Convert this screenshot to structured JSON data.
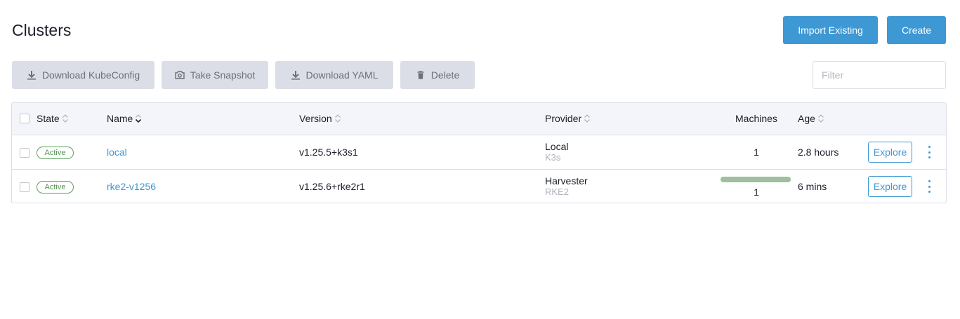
{
  "page": {
    "title": "Clusters"
  },
  "actions": {
    "import_label": "Import Existing",
    "create_label": "Create"
  },
  "bulk": {
    "download_kubeconfig": "Download KubeConfig",
    "take_snapshot": "Take Snapshot",
    "download_yaml": "Download YAML",
    "delete": "Delete"
  },
  "filter": {
    "placeholder": "Filter",
    "value": ""
  },
  "table": {
    "headers": {
      "state": "State",
      "name": "Name",
      "version": "Version",
      "provider": "Provider",
      "machines": "Machines",
      "age": "Age"
    },
    "rows": [
      {
        "state": "Active",
        "name": "local",
        "version": "v1.25.5+k3s1",
        "provider": "Local",
        "provider_sub": "K3s",
        "machines": "1",
        "age": "2.8 hours",
        "action": "Explore"
      },
      {
        "state": "Active",
        "name": "rke2-v1256",
        "version": "v1.25.6+rke2r1",
        "provider": "Harvester",
        "provider_sub": "RKE2",
        "machines": "1",
        "machines_progress": 1.0,
        "age": "6 mins",
        "action": "Explore"
      }
    ]
  },
  "colors": {
    "accent": "#3d98d3",
    "active": "#4d944d",
    "progress": "#9fbf9f"
  }
}
